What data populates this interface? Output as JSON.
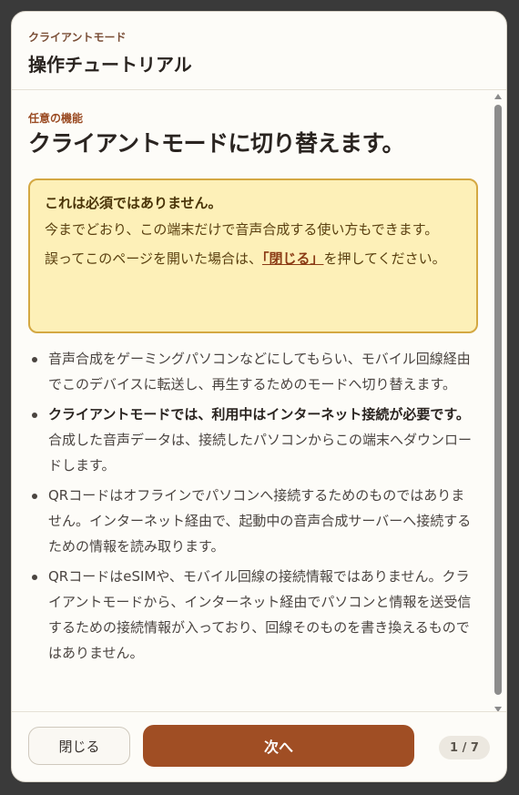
{
  "header": {
    "mode_label": "クライアントモード",
    "title": "操作チュートリアル"
  },
  "content": {
    "section_label": "任意の機能",
    "heading": "クライアントモードに切り替えます。",
    "notice": {
      "title": "これは必須ではありません。",
      "p1": "今までどおり、この端末だけで音声合成する使い方もできます。",
      "p2_before": "誤ってこのページを開いた場合は、",
      "p2_link": "「閉じる」",
      "p2_after": "を押してください。"
    },
    "bullets": [
      {
        "bold": "",
        "text": "音声合成をゲーミングパソコンなどにしてもらい、モバイル回線経由でこのデバイスに転送し、再生するためのモードへ切り替えます。"
      },
      {
        "bold": "クライアントモードでは、利用中はインターネット接続が必要です。",
        "text": " 合成した音声データは、接続したパソコンからこの端末へダウンロードします。"
      },
      {
        "bold": "",
        "text": "QRコードはオフラインでパソコンへ接続するためのものではありません。インターネット経由で、起動中の音声合成サーバーへ接続するための情報を読み取ります。"
      },
      {
        "bold": "",
        "text": "QRコードはeSIMや、モバイル回線の接続情報ではありません。クライアントモードから、インターネット経由でパソコンと情報を送受信するための接続情報が入っており、回線そのものを書き換えるものではありません。"
      }
    ]
  },
  "footer": {
    "close_label": "閉じる",
    "next_label": "次へ",
    "page_indicator": "1 / 7"
  },
  "colors": {
    "accent": "#a04e24",
    "notice_bg": "#fdf0b8",
    "notice_border": "#d4a842"
  }
}
